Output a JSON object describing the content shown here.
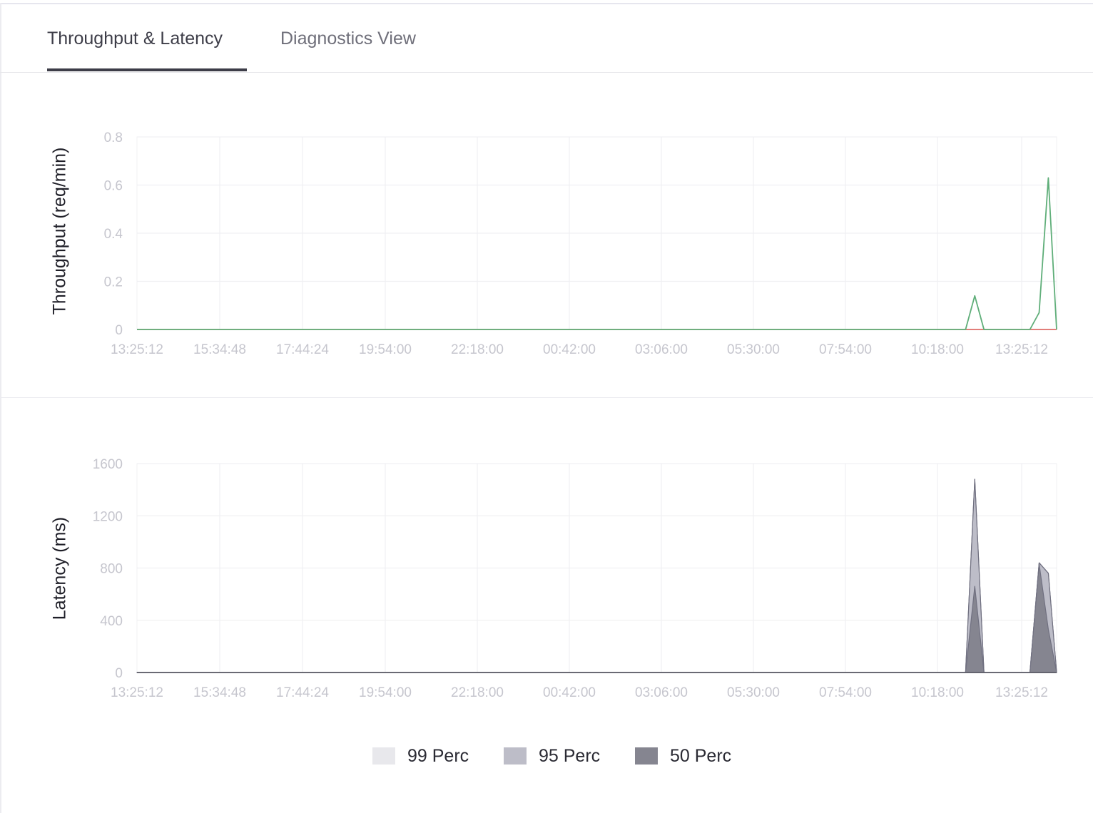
{
  "tabs": [
    {
      "label": "Throughput & Latency",
      "active": true
    },
    {
      "label": "Diagnostics View",
      "active": false
    }
  ],
  "colors": {
    "throughput_line": "#5fae79",
    "baseline_line": "#d9534f",
    "p99": "#e8e8ec",
    "p95": "#bdbdc8",
    "p50": "#858590",
    "grid": "#f0f0f3",
    "tick": "#c6c6ce"
  },
  "legend": [
    {
      "label": "99 Perc",
      "color": "#e8e8ec"
    },
    {
      "label": "95 Perc",
      "color": "#bdbdc8"
    },
    {
      "label": "50 Perc",
      "color": "#858590"
    }
  ],
  "chart_data": [
    {
      "type": "line",
      "ylabel": "Throughput (req/min)",
      "ylim": [
        0,
        0.8
      ],
      "yticks": [
        0,
        0.2,
        0.4,
        0.6,
        0.8
      ],
      "xticks": [
        "13:25:12",
        "15:34:48",
        "17:44:24",
        "19:54:00",
        "22:18:00",
        "00:42:00",
        "03:06:00",
        "05:30:00",
        "07:54:00",
        "10:18:00",
        "13:25:12"
      ],
      "grid": true,
      "series": [
        {
          "color": "#5fae79",
          "points": [
            [
              0.0,
              0
            ],
            [
              0.901,
              0
            ],
            [
              0.911,
              0.14
            ],
            [
              0.921,
              0
            ],
            [
              0.971,
              0
            ],
            [
              0.981,
              0.07
            ],
            [
              0.991,
              0.63
            ],
            [
              1.0,
              0
            ]
          ]
        }
      ]
    },
    {
      "type": "area",
      "ylabel": "Latency (ms)",
      "ylim": [
        0,
        1600
      ],
      "yticks": [
        0,
        400,
        800,
        1200,
        1600
      ],
      "xticks": [
        "13:25:12",
        "15:34:48",
        "17:44:24",
        "19:54:00",
        "22:18:00",
        "00:42:00",
        "03:06:00",
        "05:30:00",
        "07:54:00",
        "10:18:00",
        "13:25:12"
      ],
      "grid": true,
      "series": [
        {
          "name": "99 Perc",
          "color": "#e8e8ec",
          "points": [
            [
              0.0,
              0
            ],
            [
              0.901,
              0
            ],
            [
              0.911,
              1480
            ],
            [
              0.921,
              0
            ],
            [
              0.971,
              0
            ],
            [
              0.981,
              840
            ],
            [
              0.991,
              760
            ],
            [
              1.0,
              0
            ]
          ]
        },
        {
          "name": "95 Perc",
          "color": "#bdbdc8",
          "points": [
            [
              0.0,
              0
            ],
            [
              0.901,
              0
            ],
            [
              0.911,
              1480
            ],
            [
              0.921,
              0
            ],
            [
              0.971,
              0
            ],
            [
              0.981,
              840
            ],
            [
              0.991,
              760
            ],
            [
              1.0,
              0
            ]
          ]
        },
        {
          "name": "50 Perc",
          "color": "#858590",
          "points": [
            [
              0.0,
              0
            ],
            [
              0.901,
              0
            ],
            [
              0.911,
              660
            ],
            [
              0.921,
              0
            ],
            [
              0.971,
              0
            ],
            [
              0.981,
              830
            ],
            [
              0.991,
              330
            ],
            [
              1.0,
              0
            ]
          ]
        }
      ]
    }
  ]
}
